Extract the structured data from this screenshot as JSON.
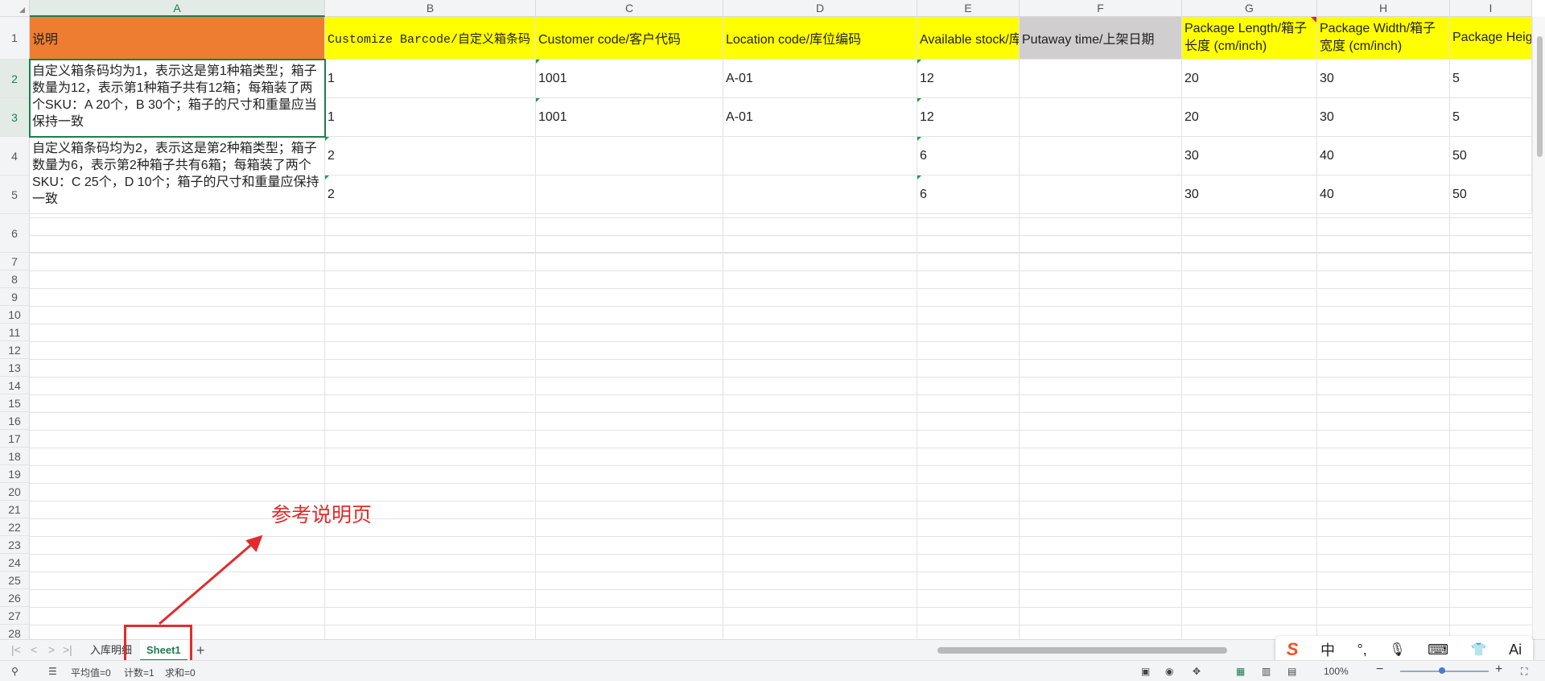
{
  "columns": [
    "A",
    "B",
    "C",
    "D",
    "E",
    "F",
    "G",
    "H",
    "I"
  ],
  "rows": [
    "1",
    "2",
    "3",
    "4",
    "5",
    "6",
    "7",
    "8",
    "9",
    "10",
    "11",
    "12",
    "13",
    "14",
    "15",
    "16",
    "17",
    "18",
    "19",
    "20",
    "21",
    "22",
    "23",
    "24",
    "25",
    "26",
    "27",
    "28"
  ],
  "header_row": {
    "a": "说明",
    "b": "Customize Barcode/自定义箱条码",
    "c": "Customer code/客户代码",
    "d": "Location code/库位编码",
    "e": "Available stock/库",
    "f": "Putaway time/上架日期",
    "g": "Package Length/箱子长度 (cm/inch)",
    "h": "Package Width/箱子宽度 (cm/inch)",
    "i": "Package Height/箱子高度 (cm/inch)"
  },
  "notes": {
    "n1": "自定义箱条码均为1，表示这是第1种箱类型；箱子数量为12，表示第1种箱子共有12箱；每箱装了两个SKU：A 20个，B 30个；箱子的尺寸和重量应当保持一致",
    "n2": "自定义箱条码均为2，表示这是第2种箱类型；箱子数量为6，表示第2种箱子共有6箱；每箱装了两个SKU：C 25个，D 10个；箱子的尺寸和重量应保持一致"
  },
  "data_rows": [
    {
      "b": "1",
      "c": "1001",
      "d": "A-01",
      "e": "12",
      "g": "20",
      "h": "30",
      "i": "5"
    },
    {
      "b": "1",
      "c": "1001",
      "d": "A-01",
      "e": "12",
      "g": "20",
      "h": "30",
      "i": "5"
    },
    {
      "b": "2",
      "c": "",
      "d": "",
      "e": "6",
      "g": "30",
      "h": "40",
      "i": "50"
    },
    {
      "b": "2",
      "c": "",
      "d": "",
      "e": "6",
      "g": "30",
      "h": "40",
      "i": "50"
    }
  ],
  "annotation": "参考说明页",
  "tabs": {
    "nav": [
      "|<",
      "<",
      ">",
      ">|"
    ],
    "sheet_intro": "入库明细",
    "sheet1": "Sheet1",
    "add": "+"
  },
  "ime": {
    "logo": "S",
    "lang": "中",
    "punct": "°,",
    "mic": "🎙",
    "keyboard": "⌨",
    "skin": "👕",
    "ai": "Ai"
  },
  "status": {
    "avg": "平均值=0",
    "count": "计数=1",
    "sum": "求和=0",
    "zoom": "100%"
  },
  "colors": {
    "header_orange": "#ef7d31",
    "header_yellow": "#ffff00",
    "header_gray": "#d0cece",
    "accent_green": "#1e7d4e",
    "annotation_red": "#e32b2b"
  }
}
